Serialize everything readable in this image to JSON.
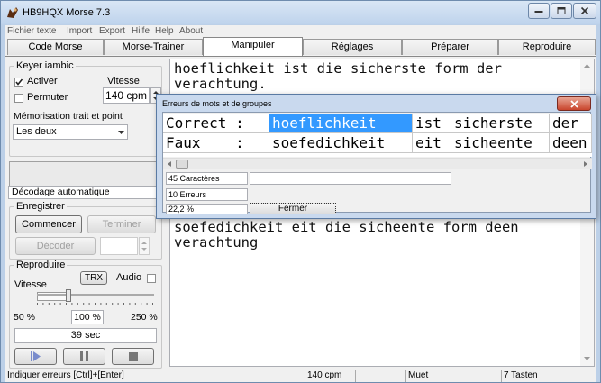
{
  "window": {
    "title": "HB9HQX Morse 7.3"
  },
  "menu": [
    "Fichier texte",
    "Import",
    "Export",
    "Hilfe",
    "Help",
    "About"
  ],
  "tabs": [
    "Code Morse",
    "Morse-Trainer",
    "Manipuler",
    "Réglages",
    "Préparer",
    "Reproduire"
  ],
  "keyer": {
    "group_label": "Keyer iambic",
    "activer_label": "Activer",
    "vitesse_label": "Vitesse",
    "permuter_label": "Permuter",
    "speed_value": "140 cpm",
    "memo_label": "Mémorisation trait et point",
    "memo_value": "Les deux"
  },
  "decode": {
    "mode_value": "Décodage automatique"
  },
  "record": {
    "group_label": "Enregistrer",
    "start_label": "Commencer",
    "stop_label": "Terminer",
    "decode_label": "Décoder"
  },
  "play": {
    "group_label": "Reproduire",
    "trx_label": "TRX",
    "audio_label": "Audio",
    "vitesse_label": "Vitesse",
    "pct_min": "50 %",
    "pct_value": "100 %",
    "pct_max": "250 %",
    "duration": "39 sec"
  },
  "text_top": {
    "line1": "hoeflichkeit ist die sicherste form der",
    "line2": "verachtung."
  },
  "text_bottom": {
    "line1": "soefedichkeit eit die sicheente form deen",
    "line2": "verachtung"
  },
  "dialog": {
    "title": "Erreurs de mots et de groupes",
    "row_correct": [
      "Correct :",
      "hoeflichkeit",
      "ist",
      "sicherste",
      "der"
    ],
    "row_faux": [
      "Faux    :",
      "soefedichkeit",
      "eit",
      "sicheente",
      "deen"
    ],
    "caracteres": "45 Caractères",
    "erreurs": "10 Erreurs",
    "percent": "22,2 %",
    "close_label": "Fermer"
  },
  "status": {
    "hint": "Indiquer erreurs  [Ctrl]+[Enter]",
    "cpm": "140 cpm",
    "mute": "Muet",
    "keys": "7 Tasten"
  },
  "colors": {
    "selection": "#3399ff",
    "title_bar": "#bed3ec",
    "close_red": "#c9452d"
  }
}
